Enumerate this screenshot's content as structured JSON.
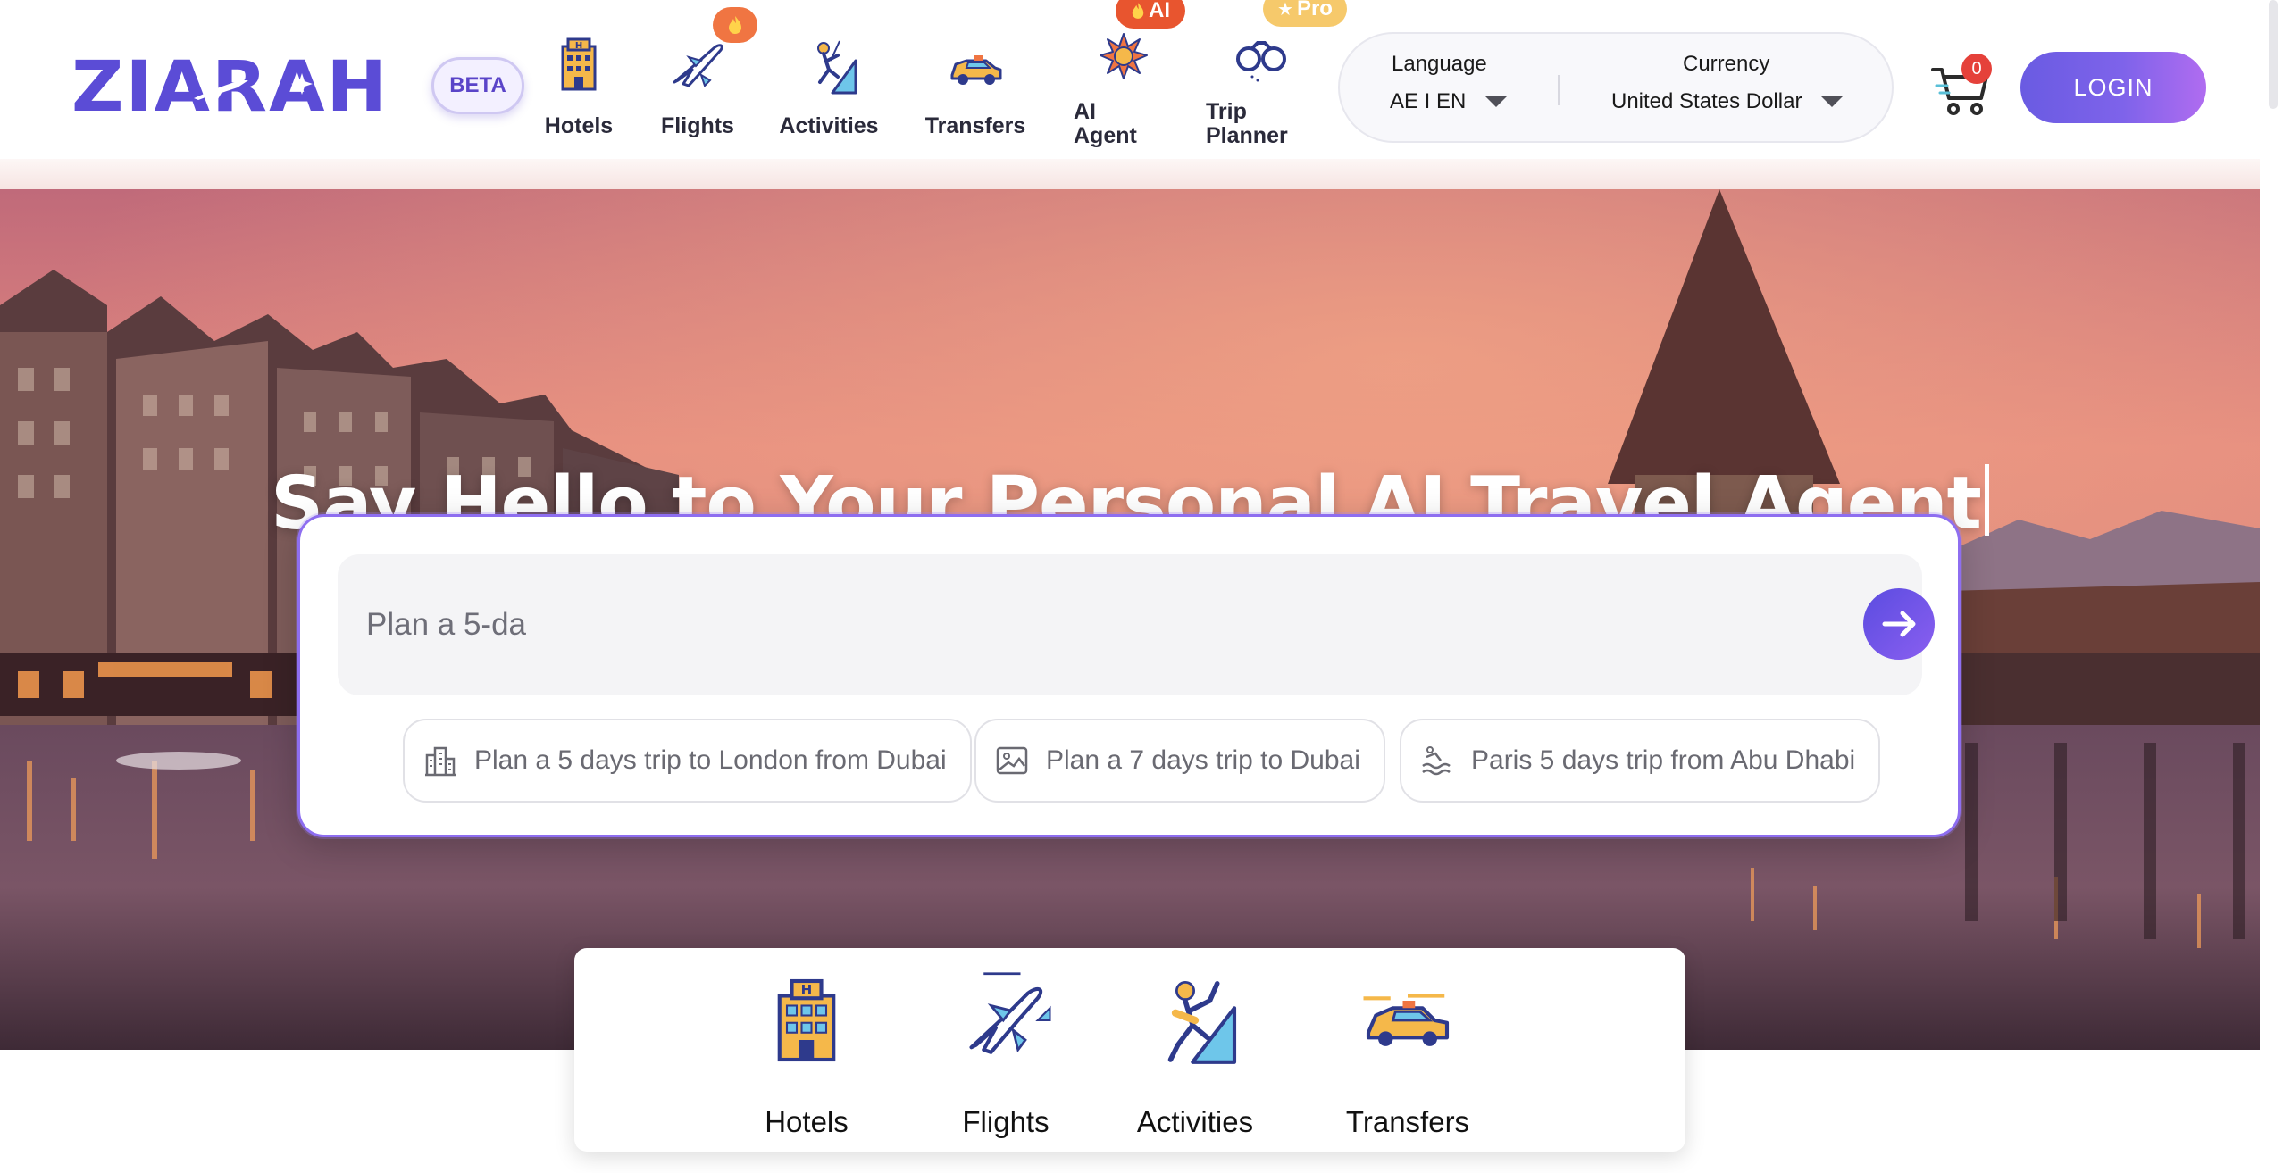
{
  "brand": {
    "logo_text": "ZIARAH",
    "beta_label": "BETA"
  },
  "nav": {
    "items": [
      {
        "label": "Hotels",
        "icon": "hotel-icon"
      },
      {
        "label": "Flights",
        "icon": "plane-icon",
        "badge": "fire-icon"
      },
      {
        "label": "Activities",
        "icon": "climber-icon"
      },
      {
        "label": "Transfers",
        "icon": "taxi-icon"
      },
      {
        "label": "AI Agent",
        "icon": "ai-burst-icon",
        "badge": "AI"
      },
      {
        "label": "Trip Planner",
        "icon": "binoculars-icon",
        "badge": "Pro"
      }
    ]
  },
  "locale": {
    "language_label": "Language",
    "language_value": "AE I EN",
    "currency_label": "Currency",
    "currency_value": "United States Dollar"
  },
  "cart": {
    "count": "0",
    "icon": "cart-icon"
  },
  "login": {
    "label": "LOGIN"
  },
  "hero": {
    "headline": "Say Hello to Your Personal AI Travel Agent"
  },
  "search": {
    "value": "Plan a 5-da",
    "submit_icon": "arrow-right-icon",
    "suggestions": [
      {
        "label": "Plan a 5 days trip to London from Dubai",
        "icon": "city-buildings-icon"
      },
      {
        "label": "Plan a 7 days trip to Dubai",
        "icon": "landscape-photo-icon"
      },
      {
        "label": "Paris 5 days trip from Abu Dhabi",
        "icon": "beach-swim-icon"
      }
    ]
  },
  "categories": [
    {
      "label": "Hotels",
      "icon": "hotel-icon"
    },
    {
      "label": "Flights",
      "icon": "plane-icon"
    },
    {
      "label": "Activities",
      "icon": "climber-icon"
    },
    {
      "label": "Transfers",
      "icon": "taxi-icon"
    }
  ],
  "colors": {
    "accent": "#6a5be2",
    "accent_light": "#b06cf0",
    "badge_orange": "#e8552f",
    "badge_pro": "#f6c96b",
    "cart_badge": "#e5413a"
  }
}
